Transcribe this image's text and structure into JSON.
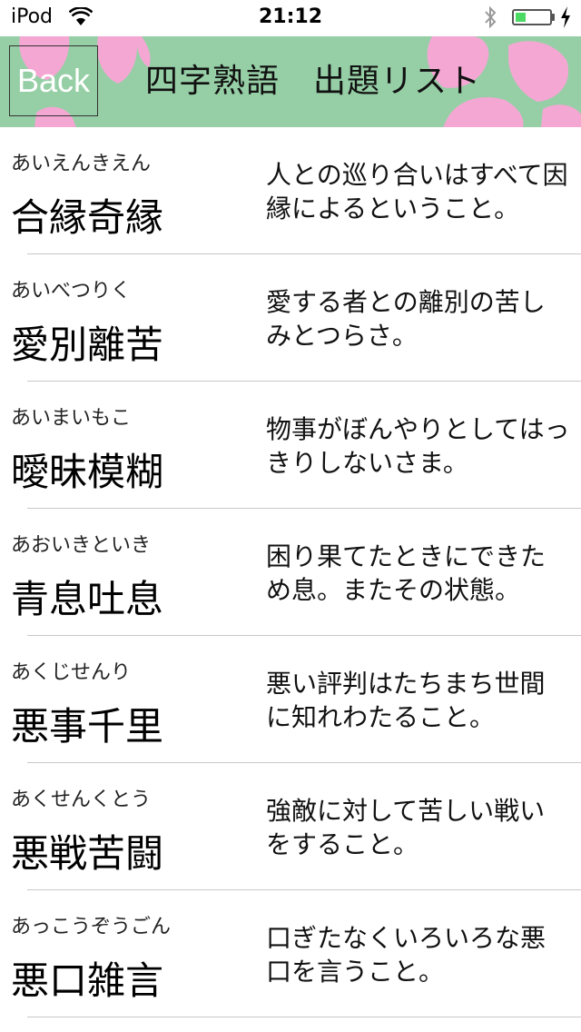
{
  "status_bar": {
    "carrier": "iPod",
    "time": "21:12",
    "battery_level": 0.3
  },
  "nav": {
    "back_label": "Back",
    "title": "四字熟語　出題リスト"
  },
  "items": [
    {
      "reading": "あいえんきえん",
      "idiom": "合縁奇縁",
      "meaning": "人との巡り合いはすべて因縁によるということ。"
    },
    {
      "reading": "あいべつりく",
      "idiom": "愛別離苦",
      "meaning": "愛する者との離別の苦しみとつらさ。"
    },
    {
      "reading": "あいまいもこ",
      "idiom": "曖昧模糊",
      "meaning": "物事がぼんやりとしてはっきりしないさま。"
    },
    {
      "reading": "あおいきといき",
      "idiom": "青息吐息",
      "meaning": "困り果てたときにできため息。またその状態。"
    },
    {
      "reading": "あくじせんり",
      "idiom": "悪事千里",
      "meaning": "悪い評判はたちまち世間に知れわたること。"
    },
    {
      "reading": "あくせんくとう",
      "idiom": "悪戦苦闘",
      "meaning": "強敵に対して苦しい戦いをすること。"
    },
    {
      "reading": "あっこうぞうごん",
      "idiom": "悪口雑言",
      "meaning": "口ぎたなくいろいろな悪口を言うこと。"
    }
  ]
}
